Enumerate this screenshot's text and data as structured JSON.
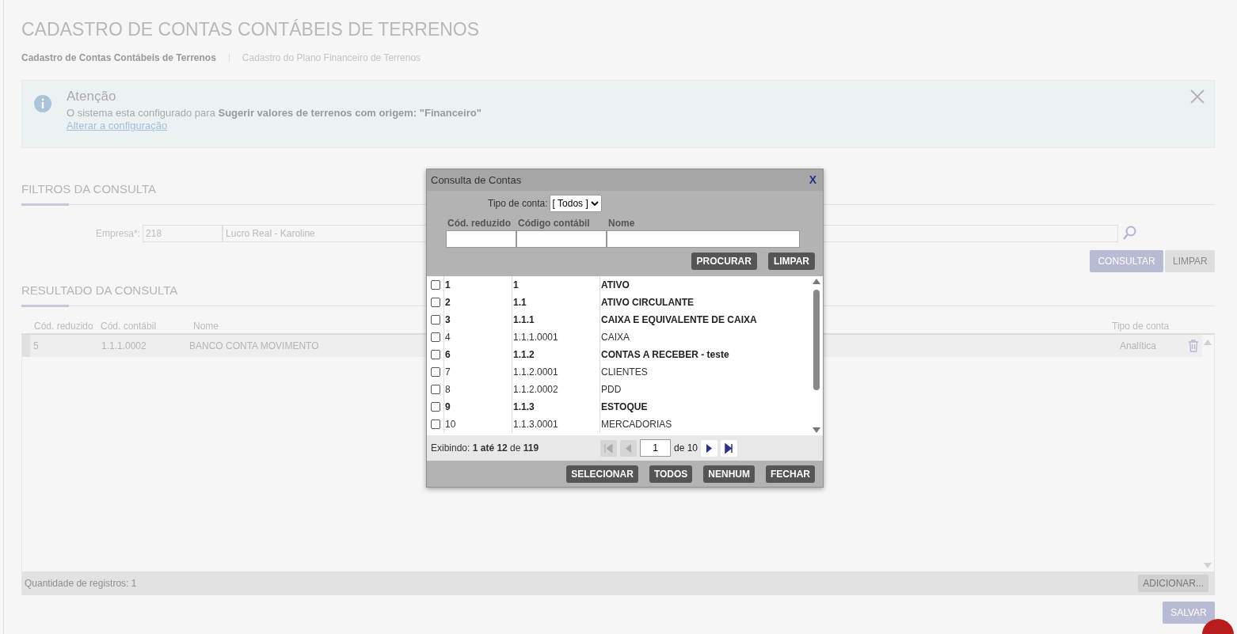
{
  "page": {
    "title": "CADASTRO DE CONTAS CONTÁBEIS DE TERRENOS"
  },
  "tabs": [
    {
      "label": "Cadastro de Contas Contábeis de Terrenos",
      "selected": true
    },
    {
      "label": "Cadastro do Plano Financeiro de Terrenos",
      "selected": false
    }
  ],
  "alert": {
    "title": "Atenção",
    "message": "O sistema esta configurado para **Sugerir valores de terrenos com origem: \"Financeiro\"**",
    "link": "Alterar a configuração"
  },
  "filters": {
    "heading": "FILTROS DA CONSULTA",
    "company_label": "Empresa*:",
    "company_code": "218",
    "company_name": "Lucro Real - Karoline",
    "buttons": [
      "CONSULTAR",
      "LIMPAR"
    ]
  },
  "results": {
    "heading": "RESULTADO DA CONSULTA",
    "columns": [
      "Cód. reduzido",
      "Cód. contábil",
      "Nome",
      "Tipo de conta"
    ],
    "rows": [
      {
        "code": "5",
        "account": "1.1.1.0002",
        "name": "BANCO CONTA MOVIMENTO",
        "type": "Analítica"
      }
    ],
    "count": "Quantidade de registros: 1",
    "add_button": "ADICIONAR..."
  },
  "save_button": "SALVAR",
  "dialog": {
    "title": "Consulta de Contas",
    "close": "X",
    "type_label": "Tipo de conta:",
    "type_value": "[ Todos ]",
    "field_labels": [
      "Cód. reduzido",
      "Código contábil",
      "Nome"
    ],
    "search_buttons": [
      "PROCURAR",
      "LIMPAR"
    ],
    "rows": [
      {
        "code": "1",
        "account": "1",
        "name": "ATIVO",
        "kind": "group",
        "checked": false
      },
      {
        "code": "2",
        "account": "1.1",
        "name": "ATIVO CIRCULANTE",
        "kind": "group",
        "checked": false
      },
      {
        "code": "3",
        "account": "1.1.1",
        "name": "CAIXA E EQUIVALENTE DE CAIXA",
        "kind": "group",
        "checked": false
      },
      {
        "code": "4",
        "account": "1.1.1.0001",
        "name": "CAIXA",
        "kind": "account",
        "checked": false
      },
      {
        "code": "6",
        "account": "1.1.2",
        "name": "CONTAS A RECEBER - teste",
        "kind": "group",
        "checked": false
      },
      {
        "code": "7",
        "account": "1.1.2.0001",
        "name": "CLIENTES",
        "kind": "account",
        "checked": false
      },
      {
        "code": "8",
        "account": "1.1.2.0002",
        "name": "PDD",
        "kind": "account",
        "checked": false
      },
      {
        "code": "9",
        "account": "1.1.3",
        "name": "ESTOQUE",
        "kind": "group",
        "checked": false
      },
      {
        "code": "10",
        "account": "1.1.3.0001",
        "name": "MERCADORIAS",
        "kind": "account",
        "checked": false
      }
    ],
    "showing": "Exibindo: **1 até 12** de **119**",
    "page": "1",
    "page_of": "de 10",
    "buttons": [
      "SELECIONAR",
      "TODOS",
      "NENHUM",
      "FECHAR"
    ]
  }
}
